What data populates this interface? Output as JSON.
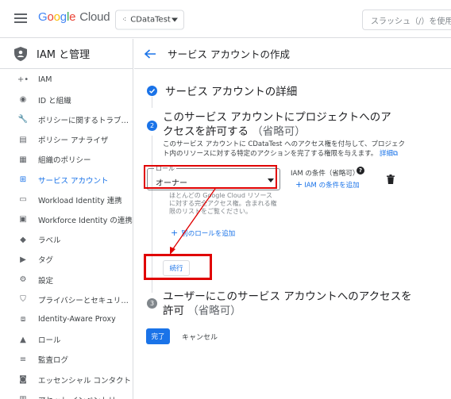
{
  "topbar": {
    "logo_google": [
      "G",
      "o",
      "o",
      "g",
      "l",
      "e"
    ],
    "logo_cloud": "Cloud",
    "project_name": "CDataTest",
    "search_placeholder": "スラッシュ（/）を使用"
  },
  "sidebar": {
    "title": "IAM と管理",
    "items": [
      {
        "label": "IAM",
        "icon": "person-add-icon"
      },
      {
        "label": "ID と組織",
        "icon": "account-circle-icon"
      },
      {
        "label": "ポリシーに関するトラブル…",
        "icon": "wrench-icon"
      },
      {
        "label": "ポリシー アナライザ",
        "icon": "document-search-icon"
      },
      {
        "label": "組織のポリシー",
        "icon": "list-box-icon"
      },
      {
        "label": "サービス アカウント",
        "icon": "service-account-icon",
        "active": true
      },
      {
        "label": "Workload Identity 連携",
        "icon": "id-card-icon"
      },
      {
        "label": "Workforce Identity の連携",
        "icon": "id-card-list-icon"
      },
      {
        "label": "ラベル",
        "icon": "label-icon"
      },
      {
        "label": "タグ",
        "icon": "tag-icon"
      },
      {
        "label": "設定",
        "icon": "settings-gear-icon"
      },
      {
        "label": "プライバシーとセキュリティ",
        "icon": "privacy-shield-icon"
      },
      {
        "label": "Identity-Aware Proxy",
        "icon": "proxy-icon"
      },
      {
        "label": "ロール",
        "icon": "roles-hat-icon"
      },
      {
        "label": "監査ログ",
        "icon": "audit-log-icon"
      },
      {
        "label": "エッセンシャル コンタクト",
        "icon": "contact-icon"
      },
      {
        "label": "アセット インベントリ",
        "icon": "inventory-icon"
      }
    ]
  },
  "main": {
    "page_title": "サービス アカウントの作成",
    "step1_title": "サービス アカウントの詳細",
    "step2_num": "2",
    "step2_title": "このサービス アカウントにプロジェクトへのアクセスを許可する",
    "step2_optional": "（省略可）",
    "description": "このサービス アカウントに CDataTest へのアクセス権を付与して、プロジェクト内のリソースに対する特定のアクションを完了する権限を与えます。",
    "details_link": "詳細",
    "role_label": "ロール",
    "role_value": "オーナー",
    "role_hint": "ほとんどの Google Cloud リソースに対する完全アクセス権。含まれる権限のリストをご覧ください。",
    "iam_condition_label": "IAM の条件（省略可）",
    "add_iam_condition": "IAM の条件を追加",
    "add_another_role": "別のロールを追加",
    "continue_button": "続行",
    "step3_num": "3",
    "step3_title": "ユーザーにこのサービス アカウントへのアクセスを許可",
    "step3_optional": "（省略可）",
    "done_button": "完了",
    "cancel_button": "キャンセル"
  },
  "colors": {
    "accent": "#1a73e8",
    "annotation_red": "#e00000"
  }
}
